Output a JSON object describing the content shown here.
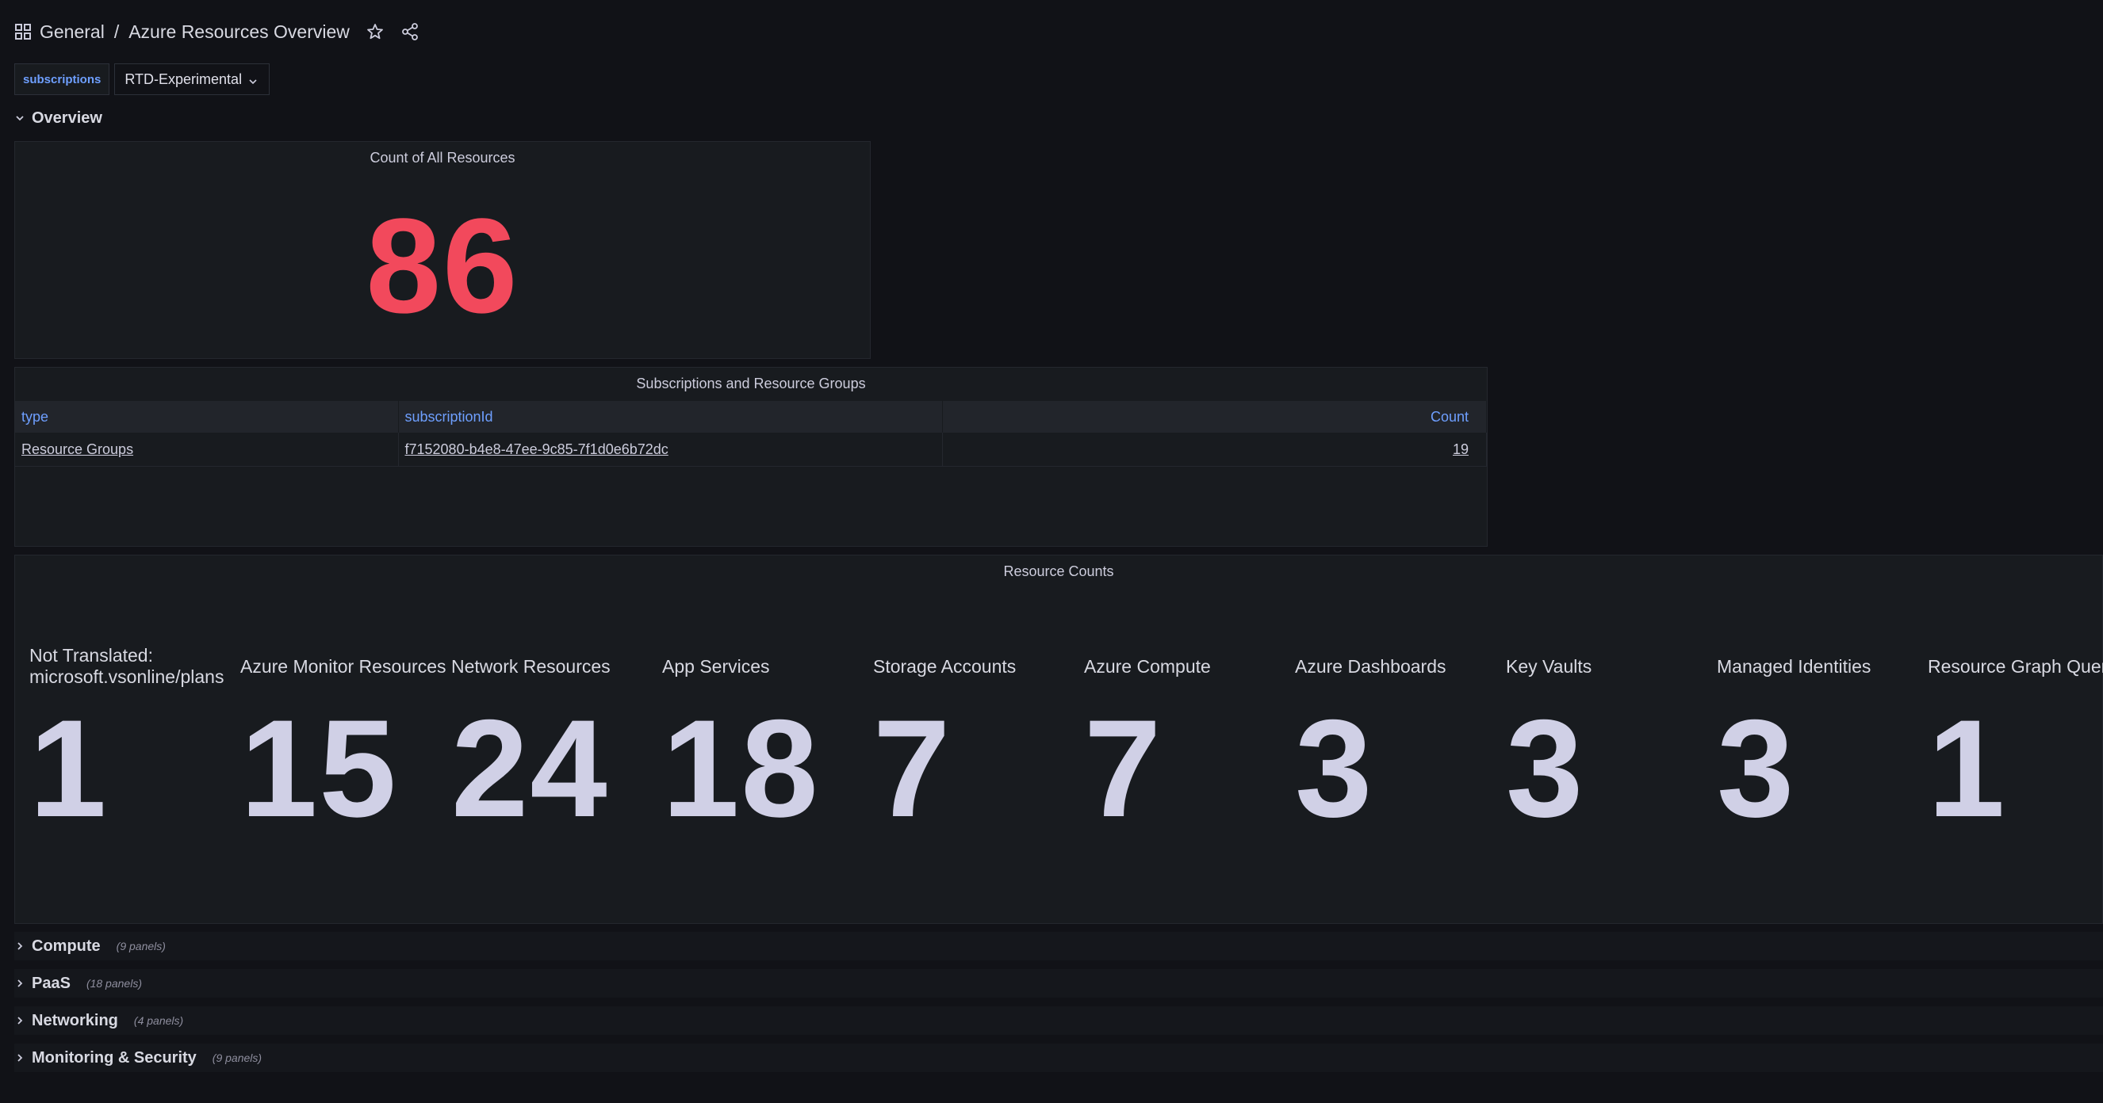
{
  "header": {
    "folder": "General",
    "separator": "/",
    "title": "Azure Resources Overview"
  },
  "variables": {
    "label": "subscriptions",
    "selected": "RTD-Experimental"
  },
  "overview_row": {
    "title": "Overview"
  },
  "count_panel": {
    "title": "Count of All Resources",
    "value": "86",
    "color": "#f2495c"
  },
  "subs_panel": {
    "title": "Subscriptions and Resource Groups",
    "columns": [
      "type",
      "subscriptionId",
      "Count"
    ],
    "rows": [
      {
        "type": "Resource Groups",
        "subscriptionId": "f7152080-b4e8-47ee-9c85-7f1d0e6b72dc",
        "count": "19"
      }
    ]
  },
  "resource_counts": {
    "title": "Resource Counts",
    "items": [
      {
        "label": "Not Translated: microsoft.vsonline/plans",
        "value": "1"
      },
      {
        "label": "Azure Monitor Resources",
        "value": "15"
      },
      {
        "label": "Network Resources",
        "value": "24"
      },
      {
        "label": "App Services",
        "value": "18"
      },
      {
        "label": "Storage Accounts",
        "value": "7"
      },
      {
        "label": "Azure Compute",
        "value": "7"
      },
      {
        "label": "Azure Dashboards",
        "value": "3"
      },
      {
        "label": "Key Vaults",
        "value": "3"
      },
      {
        "label": "Managed Identities",
        "value": "3"
      },
      {
        "label": "Resource Graph Queries",
        "value": "1"
      }
    ]
  },
  "collapsed_rows": [
    {
      "title": "Compute",
      "count": "(9 panels)"
    },
    {
      "title": "PaaS",
      "count": "(18 panels)"
    },
    {
      "title": "Networking",
      "count": "(4 panels)"
    },
    {
      "title": "Monitoring & Security",
      "count": "(9 panels)"
    }
  ],
  "colors": {
    "background": "#111217",
    "panel": "#181b1f",
    "accent_blue": "#6e9fff",
    "stat_red": "#f2495c"
  },
  "icons": [
    "grid-icon",
    "star-icon",
    "share-icon",
    "chevron-down-icon",
    "chevron-right-icon"
  ]
}
